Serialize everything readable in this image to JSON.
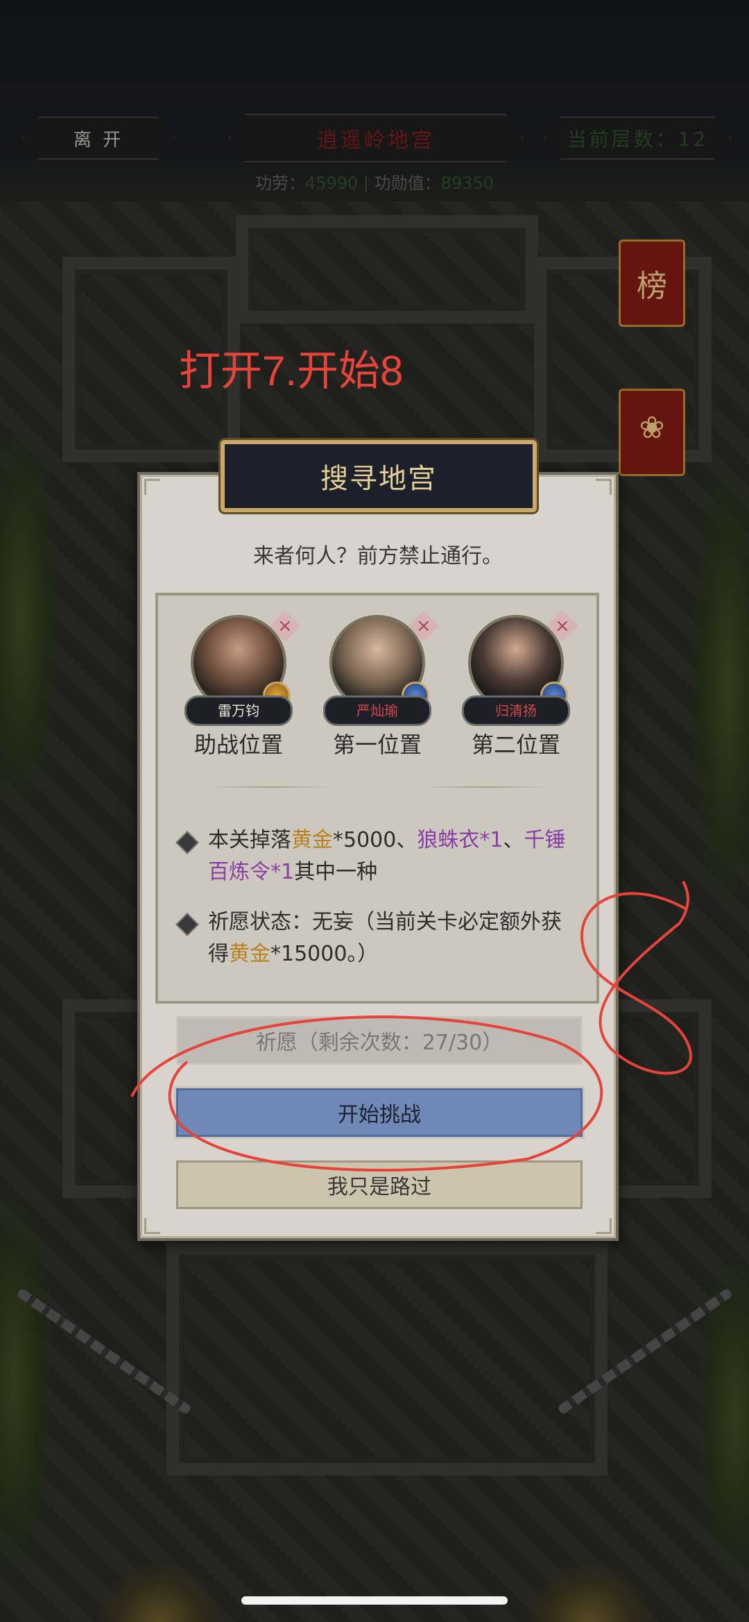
{
  "topbar": {
    "leave_label": "离 开",
    "map_title": "逍遥岭地宫",
    "floor_label": "当前层数：12",
    "merit_label": "功劳：",
    "merit_value": "45990",
    "merit_points_label": "功勋值：",
    "merit_points_value": "89350"
  },
  "side_badges": [
    {
      "glyph": "榜",
      "icon": "ranking-banner-icon"
    },
    {
      "glyph": "",
      "icon": "lotus-banner-icon"
    }
  ],
  "annotation": {
    "text": "打开7.开始8",
    "color": "#e6433b"
  },
  "dialog": {
    "title": "搜寻地宫",
    "subtitle": "来者何人？前方禁止通行。",
    "heroes": [
      {
        "name": "雷万钧",
        "position": "助战位置",
        "name_color": "#e9e4da",
        "emblem": "gold-emblem-icon"
      },
      {
        "name": "严灿瑜",
        "position": "第一位置",
        "name_color": "#d24a4a",
        "emblem": "blue-emblem-icon"
      },
      {
        "name": "归清扬",
        "position": "第二位置",
        "name_color": "#d24a4a",
        "emblem": "blue-emblem-icon"
      }
    ],
    "drop_info": {
      "prefix": "本关掉落",
      "gold": "黄金",
      "gold_qty": "*5000",
      "sep1": "、",
      "item1": "狼蛛衣",
      "item1_qty": "*1",
      "sep2": "、",
      "item2": "千锤百炼令",
      "item2_qty": "*1",
      "suffix": "其中一种"
    },
    "wish_status": {
      "prefix": "祈愿状态：无妄（当前关卡必定额外获得",
      "gold": "黄金",
      "suffix": "*15000。）"
    },
    "buttons": {
      "wish": "祈愿（剩余次数：27/30）",
      "start": "开始挑战",
      "pass": "我只是路过"
    }
  },
  "colors": {
    "gold_text": "#b7811c",
    "purple_text": "#8a3da3",
    "start_button": "#6f88b5"
  }
}
